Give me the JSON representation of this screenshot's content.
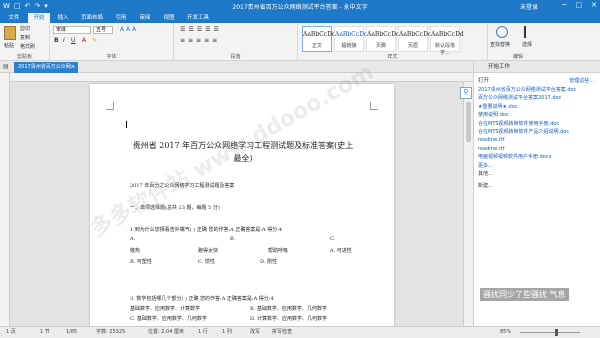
{
  "titlebar": {
    "title": "2017贵州省百万公众网络测试平台答案 - 永中文字",
    "user": "未登录",
    "qat": [
      "W",
      "□",
      "↶",
      "↷",
      "▾"
    ],
    "min": "─",
    "max": "□",
    "close": "✕"
  },
  "tabs": [
    "文件",
    "开始",
    "插入",
    "页面布局",
    "引用",
    "审阅",
    "视图",
    "开发工具"
  ],
  "ribbon": {
    "clipboard": {
      "paste": "粘贴",
      "cut": "剪切",
      "copy": "复制",
      "format": "格式刷",
      "label": "剪贴板"
    },
    "font": {
      "name": "宋体",
      "size": "五号",
      "bold": "B",
      "italic": "I",
      "underline": "U",
      "label": "字体"
    },
    "paragraph": {
      "label": "段落"
    },
    "styles": {
      "items": [
        {
          "sample": "AaBbCcDd",
          "name": "正文"
        },
        {
          "sample": "AaBbCcDd",
          "name": "超链接"
        },
        {
          "sample": "AaBbCcDd",
          "name": "页脚"
        },
        {
          "sample": "AaBbCcDd",
          "name": "页眉"
        },
        {
          "sample": "AaBbCcDd",
          "name": "默认段落字..."
        }
      ],
      "label": "样式"
    },
    "edit": {
      "find": "查找替换",
      "select": "选择",
      "label": "编辑"
    }
  },
  "doctab": {
    "name": "2017贵州省百万公众网...",
    "close": "✕"
  },
  "document": {
    "title_line1": "贵州省 2017 年百万公众网络学习工程测试题及标准答案(史上",
    "title_line2": "最全)",
    "subtitle": "2017 年百分之公众网络学习工程测试题及答案",
    "section": "一、单项选择题(总共 23 题，每题 5 分)",
    "q1": "1.到为什么您择看告外嘴气( ) 正确 您的作答:A  正确答案是:A  得分:4",
    "q1_options": [
      {
        "a": "A.",
        "b": "B.",
        "c": "C."
      },
      {
        "a": "敬热",
        "b": "跑得太快",
        "c": "帮助呼吸",
        "d": "A. 可进性"
      }
    ],
    "q1_row3": {
      "a": "B. 可塑性",
      "b": "C. 惯性",
      "c": "D. 刚性"
    },
    "q3": "3. 数学包括哪几个部分( )  正确 您的作答:A  正确答案是:A  得分:4",
    "q3_row1": {
      "a": "基础数学、应用数学、计算数学",
      "b": "B. 基础数学、应用数学、几何数学"
    },
    "q3_row2": {
      "a": "C. 基础数学、应用数学、几何数学",
      "b": "D. 计算数学、应用数学、几何数学"
    }
  },
  "rightpanel": {
    "title": "开始工作",
    "open_label": "打开",
    "manage": "管理这些...",
    "files": [
      "2017贵州省百万公众网络测试平台答案.doc",
      "百万公众网络测试平台答案2017.doc",
      "★重要说明★.doc",
      "使用说明.doc",
      "合在MTS视频转换软件使用手册.doc",
      "合在MTS视频转换软件产品介绍说明.doc",
      "readme.rtf",
      "readme.rtf",
      "电脑视频视频软件用户手册.docx",
      "更多..."
    ],
    "other": [
      "其他...",
      "新建..."
    ]
  },
  "status": {
    "page": "1 页",
    "section": "1 节",
    "pages": "1/85",
    "words": "字数: 25325",
    "position": "位置: 2.04 厘米",
    "line": "1 行",
    "col": "1 列",
    "mode": "改写",
    "spell": "拼写检查",
    "zoom": "85%"
  },
  "toast": "骚扰同少了些骚扰 气息",
  "watermark": "多多软件站 www.ddooo.com"
}
